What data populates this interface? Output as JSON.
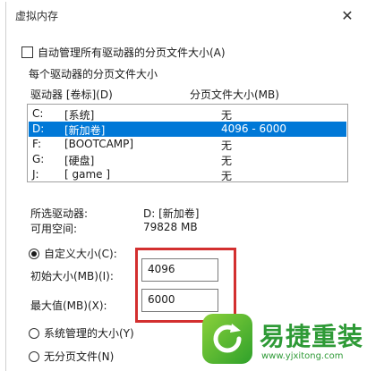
{
  "window": {
    "title": "虚拟内存",
    "close_glyph": "✕"
  },
  "auto_manage": {
    "label": "自动管理所有驱动器的分页文件大小(A)",
    "checked": false
  },
  "group": {
    "title": "每个驱动器的分页文件大小",
    "col_drive": "驱动器 [卷标](D)",
    "col_size": "分页文件大小(MB)",
    "drives": [
      {
        "drive": "C:",
        "label": "[系统]",
        "size": "无",
        "selected": false
      },
      {
        "drive": "D:",
        "label": "[新加卷]",
        "size": "4096 - 6000",
        "selected": true
      },
      {
        "drive": "F:",
        "label": "[BOOTCAMP]",
        "size": "无",
        "selected": false
      },
      {
        "drive": "G:",
        "label": "[硬盘]",
        "size": "无",
        "selected": false
      },
      {
        "drive": "J:",
        "label": "[ game ]",
        "size": "无",
        "selected": false
      }
    ]
  },
  "selected_info": {
    "drive_label": "所选驱动器:",
    "drive_value": "D:  [新加卷]",
    "space_label": "可用空间:",
    "space_value": "79828 MB"
  },
  "options": {
    "custom_label": "自定义大小(C):",
    "initial_label": "初始大小(MB)(I):",
    "initial_value": "4096",
    "max_label": "最大值(MB)(X):",
    "max_value": "6000",
    "system_label": "系统管理的大小(Y)",
    "none_label": "无分页文件(N)"
  },
  "watermark": {
    "brand": "易捷重装",
    "url": "www.yjxitong.com"
  },
  "colors": {
    "selection": "#0078d7",
    "highlight": "#d32f2f",
    "brand_green": "#2e9a36"
  }
}
